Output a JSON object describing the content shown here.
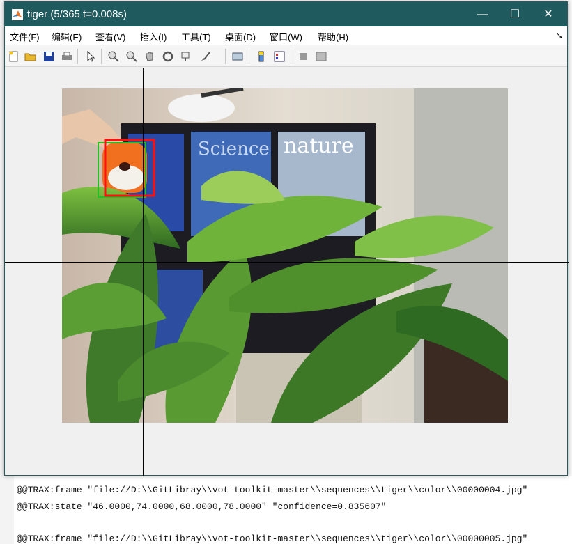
{
  "window": {
    "title": "tiger (5/365 t=0.008s)",
    "minimize_glyph": "—",
    "maximize_glyph": "☐",
    "close_glyph": "✕"
  },
  "menu": {
    "items": [
      "文件(F)",
      "编辑(E)",
      "查看(V)",
      "插入(I)",
      "工具(T)",
      "桌面(D)",
      "窗口(W)",
      "帮助(H)"
    ],
    "dock_arrow": "↘"
  },
  "toolbar": {
    "icons": [
      "new-figure-icon",
      "open-icon",
      "save-icon",
      "print-icon",
      "pointer-icon",
      "zoom-in-icon",
      "zoom-out-icon",
      "pan-icon",
      "rotate-icon",
      "data-cursor-icon",
      "brush-icon",
      "link-plot-icon",
      "colorbar-icon",
      "legend-icon",
      "hide-plot-tools-icon",
      "show-plot-tools-icon"
    ]
  },
  "tracker": {
    "ground_truth_color": "#22c022",
    "prediction_color": "#ff1010"
  },
  "console": {
    "lines": [
      "@@TRAX:frame \"file://D:\\\\GitLibray\\\\vot-toolkit-master\\\\sequences\\\\tiger\\\\color\\\\00000004.jpg\"",
      "@@TRAX:state \"46.0000,74.0000,68.0000,78.0000\" \"confidence=0.835607\"",
      "",
      "@@TRAX:frame \"file://D:\\\\GitLibray\\\\vot-toolkit-master\\\\sequences\\\\tiger\\\\color\\\\00000005.jpg\""
    ]
  }
}
